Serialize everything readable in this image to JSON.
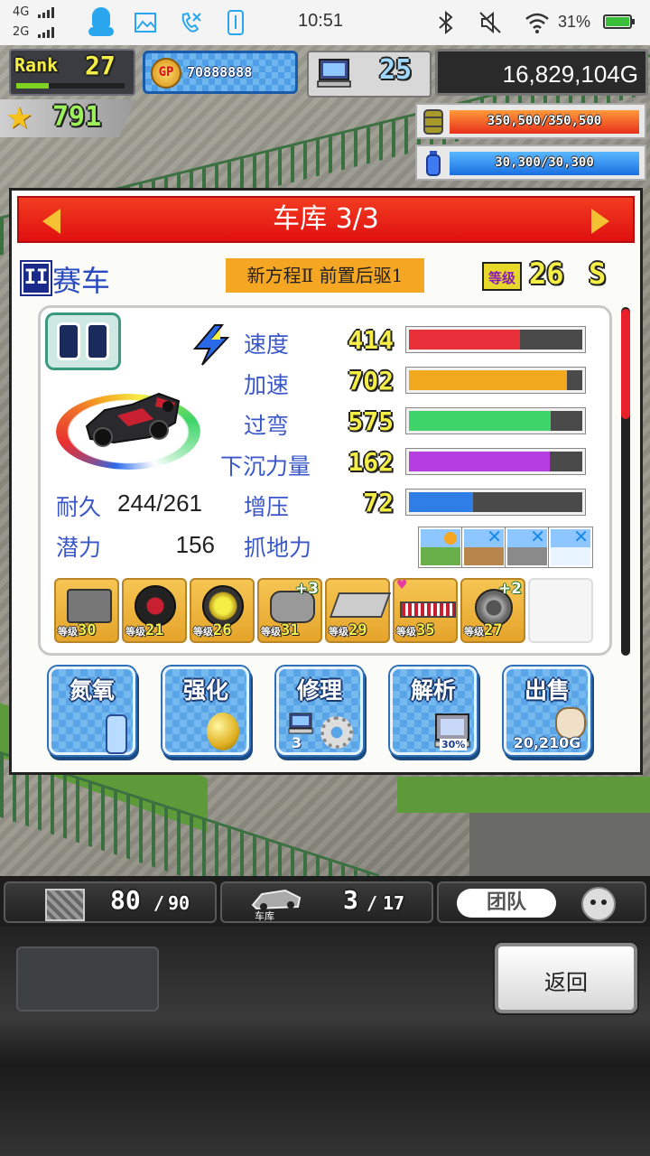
{
  "status_bar": {
    "net1": "4G",
    "net2": "2G",
    "time": "10:51",
    "battery": "31%"
  },
  "hud": {
    "rank_label": "Rank",
    "rank_value": "27",
    "gp_label": "GP",
    "gp_value": "70888888",
    "pc_count": "25",
    "gold": "16,829,104G",
    "star_value": "791",
    "fuel": "350,500/350,500",
    "fuel_fraction": 1.0,
    "water": "30,300/30,300",
    "water_fraction": 1.0
  },
  "dialog": {
    "title": "车库 3/3",
    "car_class": "II",
    "car_type": "赛车",
    "car_name": "新方程Ⅱ 前置后驱1",
    "level_label": "等级",
    "level_value": "26",
    "grade": "S",
    "stats": [
      {
        "label": "速度",
        "value": "414",
        "fraction": 0.64,
        "color": "#e8303a"
      },
      {
        "label": "加速",
        "value": "702",
        "fraction": 0.91,
        "color": "#f2a81e"
      },
      {
        "label": "过弯",
        "value": "575",
        "fraction": 0.82,
        "color": "#3fd46a"
      },
      {
        "label": "下沉力量",
        "value": "162",
        "fraction": 0.81,
        "color": "#b63ee0"
      },
      {
        "label": "增压",
        "value": "72",
        "fraction": 0.37,
        "color": "#2f7ee8"
      }
    ],
    "durability_label": "耐久",
    "durability_value": "244/261",
    "potential_label": "潜力",
    "potential_value": "156",
    "grip_label": "抓地力",
    "parts": [
      {
        "name": "engine",
        "level": "30",
        "plus": ""
      },
      {
        "name": "tire",
        "level": "21",
        "plus": ""
      },
      {
        "name": "wheel",
        "level": "26",
        "plus": ""
      },
      {
        "name": "turbo",
        "level": "31",
        "plus": "+3"
      },
      {
        "name": "spoiler",
        "level": "29",
        "plus": ""
      },
      {
        "name": "suspension",
        "level": "35",
        "plus": ""
      },
      {
        "name": "brake",
        "level": "27",
        "plus": "+2"
      }
    ],
    "part_level_label": "等级",
    "actions": [
      {
        "label": "氮氧",
        "sub": ""
      },
      {
        "label": "强化",
        "sub": ""
      },
      {
        "label": "修理",
        "sub": "3"
      },
      {
        "label": "解析",
        "sub": "30%"
      },
      {
        "label": "出售",
        "sub": "20,210G"
      }
    ]
  },
  "bottom": {
    "box_count": "80",
    "box_max": "90",
    "garage_label": "车库",
    "garage_count": "3",
    "garage_max": "17",
    "team_label": "团队",
    "back_label": "返回"
  }
}
